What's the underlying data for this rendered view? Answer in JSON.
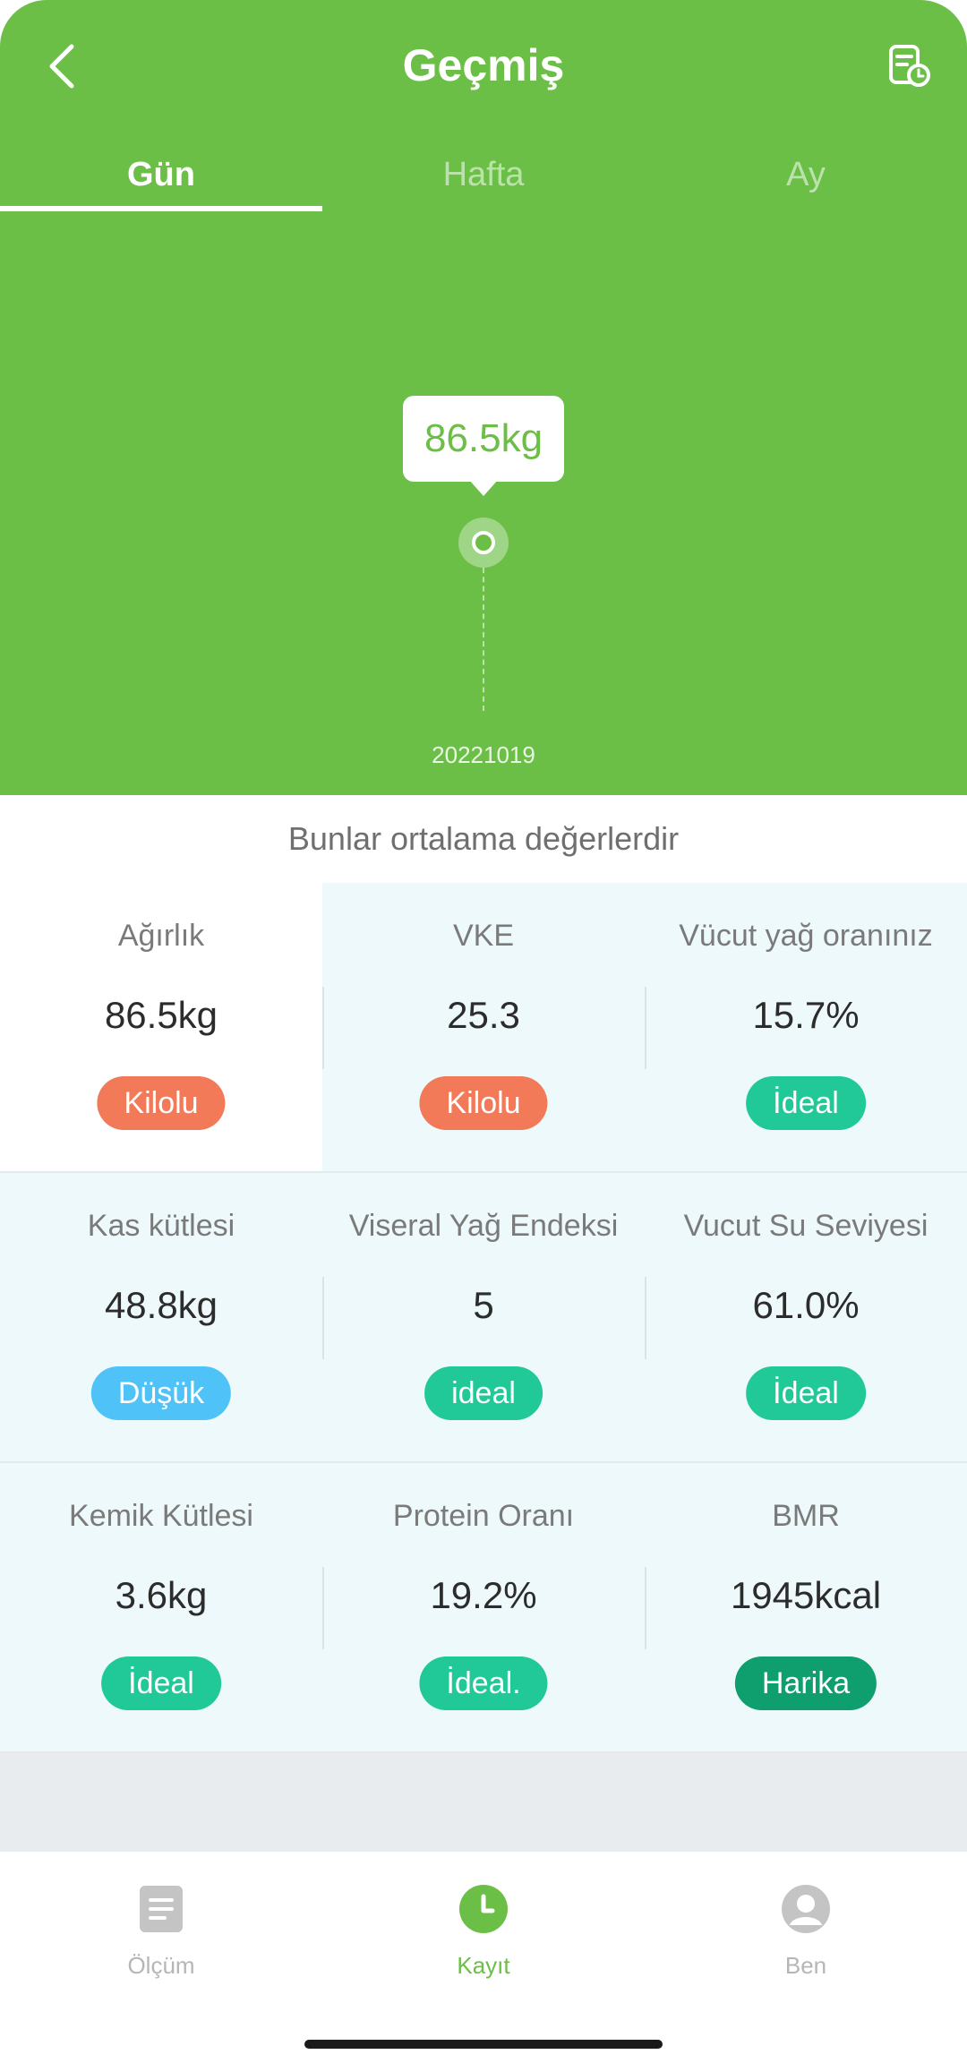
{
  "header": {
    "title": "Geçmiş",
    "back_icon": "back-arrow-icon",
    "history_icon": "history-document-icon"
  },
  "tabs": [
    {
      "label": "Gün",
      "active": true
    },
    {
      "label": "Hafta",
      "active": false
    },
    {
      "label": "Ay",
      "active": false
    }
  ],
  "chart_data": {
    "type": "line",
    "x": [
      "20221019"
    ],
    "series": [
      {
        "values": [
          86.5
        ]
      }
    ],
    "tooltip": "86.5kg",
    "x_tick_labels": [
      "20221019"
    ]
  },
  "summary": {
    "note": "Bunlar ortalama değerlerdir"
  },
  "metrics": [
    {
      "label": "Ağırlık",
      "value": "86.5kg",
      "status": "Kilolu",
      "status_color": "#f27a58"
    },
    {
      "label": "VKE",
      "value": "25.3",
      "status": "Kilolu",
      "status_color": "#f27a58"
    },
    {
      "label": "Vücut yağ oranınız",
      "value": "15.7%",
      "status": "İdeal",
      "status_color": "#20c997"
    },
    {
      "label": "Kas kütlesi",
      "value": "48.8kg",
      "status": "Düşük",
      "status_color": "#4fc3f7"
    },
    {
      "label": "Viseral Yağ Endeksi",
      "value": "5",
      "status": "ideal",
      "status_color": "#20c997"
    },
    {
      "label": "Vucut Su Seviyesi",
      "value": "61.0%",
      "status": "İdeal",
      "status_color": "#20c997"
    },
    {
      "label": "Kemik Kütlesi",
      "value": "3.6kg",
      "status": "İdeal",
      "status_color": "#20c997"
    },
    {
      "label": "Protein Oranı",
      "value": "19.2%",
      "status": "İdeal.",
      "status_color": "#20c997"
    },
    {
      "label": "BMR",
      "value": "1945kcal",
      "status": "Harika",
      "status_color": "#0f9e6e"
    }
  ],
  "bottom_nav": [
    {
      "label": "Ölçüm",
      "icon": "document-icon",
      "active": false
    },
    {
      "label": "Kayıt",
      "icon": "clock-icon",
      "active": true
    },
    {
      "label": "Ben",
      "icon": "user-icon",
      "active": false
    }
  ],
  "colors": {
    "primary": "#6cbf46",
    "metrics_bg": "#eef9fb"
  }
}
